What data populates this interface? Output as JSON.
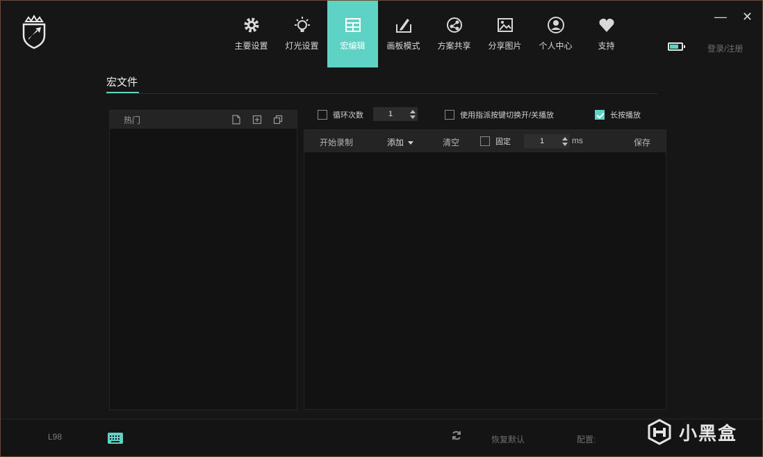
{
  "nav": {
    "items": [
      {
        "label": "主要设置",
        "icon": "gear-icon"
      },
      {
        "label": "灯光设置",
        "icon": "lightbulb-icon"
      },
      {
        "label": "宏编辑",
        "icon": "grid-icon"
      },
      {
        "label": "画板模式",
        "icon": "drawing-board-icon"
      },
      {
        "label": "方案共享",
        "icon": "share-scheme-icon"
      },
      {
        "label": "分享图片",
        "icon": "share-image-icon"
      },
      {
        "label": "个人中心",
        "icon": "user-icon"
      },
      {
        "label": "支持",
        "icon": "heart-icon"
      }
    ],
    "active_index": 2
  },
  "window": {
    "minimize": "—",
    "close": "✕"
  },
  "header": {
    "login_label": "登录/注册"
  },
  "section": {
    "tab_label": "宏文件"
  },
  "left_panel": {
    "header_label": "热门"
  },
  "options": {
    "loop_label": "循环次数",
    "loop_value": "1",
    "loop_checked": false,
    "toggle_label": "使用指派按键切换开/关播放",
    "toggle_checked": false,
    "hold_label": "长按播放",
    "hold_checked": true
  },
  "toolbar": {
    "record_label": "开始录制",
    "add_label": "添加",
    "clear_label": "清空",
    "fixed_label": "固定",
    "fixed_checked": false,
    "delay_value": "1",
    "delay_unit": "ms",
    "save_label": "保存"
  },
  "footer": {
    "model": "L98",
    "restore_label": "恢复默认",
    "config_label": "配置:"
  },
  "watermark": {
    "text": "小黑盒"
  },
  "colors": {
    "accent": "#5ed2c4",
    "background": "#161616",
    "panel": "#121212",
    "toolbar": "#242424"
  }
}
